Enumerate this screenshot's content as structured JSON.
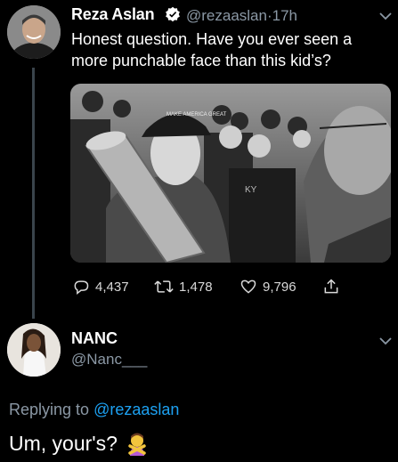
{
  "tweet": {
    "author_name": "Reza Aslan",
    "handle": "@rezaaslan",
    "separator": "·",
    "time": "17h",
    "text": "Honest question. Have you ever seen a more punchable face than this kid’s?",
    "photo_caption_cap": "MAKE AMERICA GREAT",
    "actions": {
      "replies": "4,437",
      "retweets": "1,478",
      "likes": "9,796"
    }
  },
  "reply": {
    "author_name": "NANC",
    "handle": "@Nanc___",
    "replying_label": "Replying to",
    "replying_to": "@rezaaslan",
    "text": "Um, your's?",
    "emoji": "person-gesturing-no"
  },
  "colors": {
    "background": "#000000",
    "secondary_text": "#8b98a5",
    "link": "#1da1f2",
    "verified": "#ffffff"
  }
}
